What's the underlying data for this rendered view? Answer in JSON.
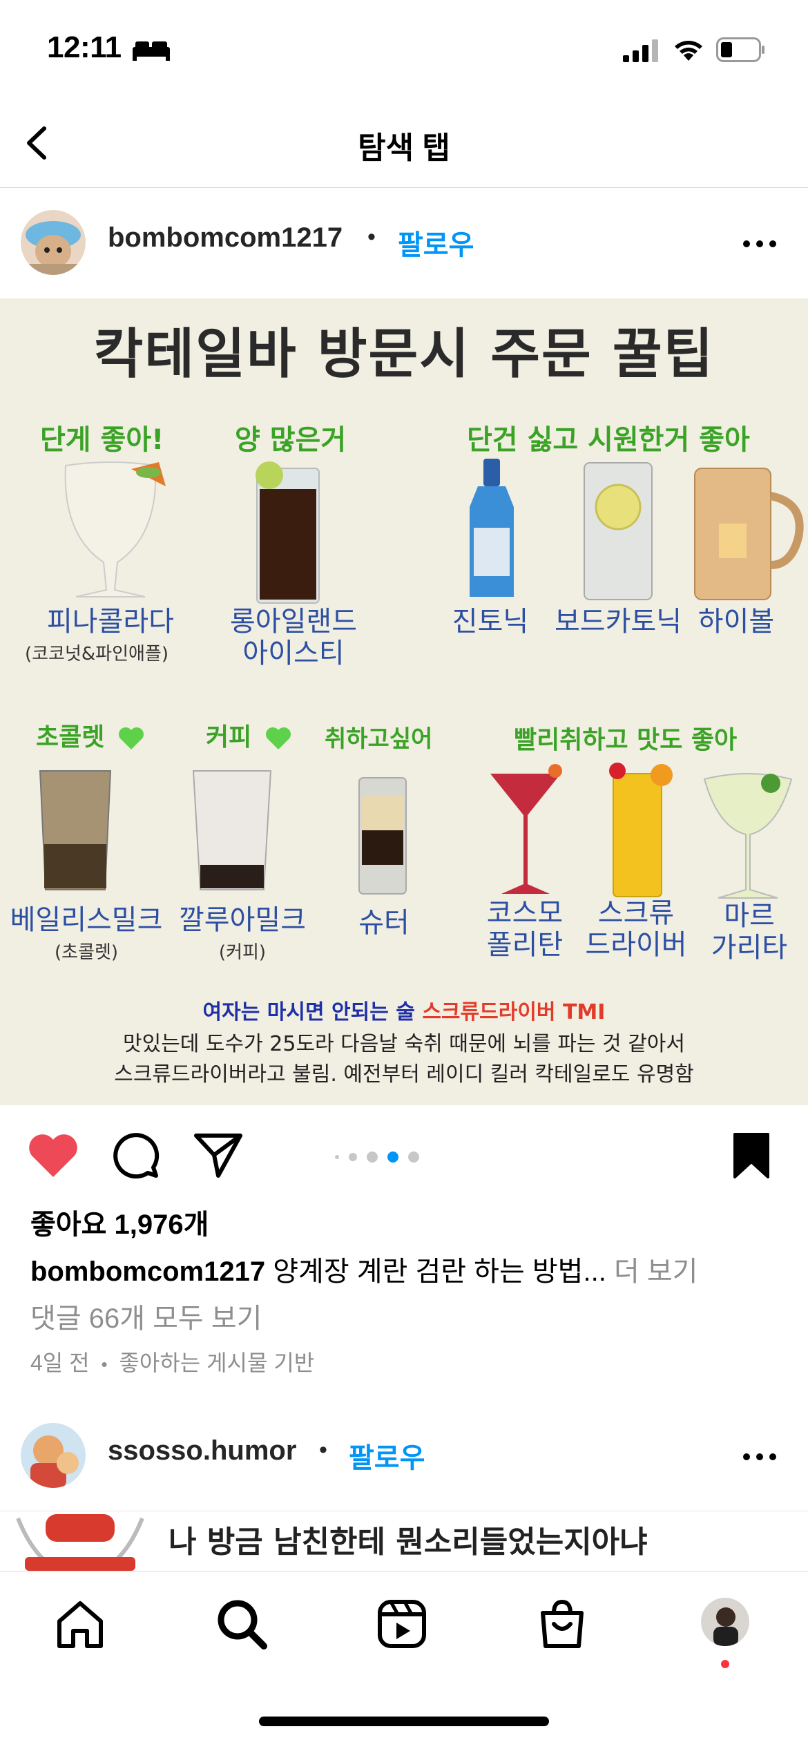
{
  "status_bar": {
    "time": "12:11"
  },
  "header": {
    "title": "탐색 탭"
  },
  "post": {
    "username": "bombomcom1217",
    "separator": "•",
    "follow_label": "팔로우",
    "image": {
      "title": "칵테일바 방문시 주문 꿀팁",
      "categories": {
        "sweet": "단게 좋아!",
        "volume": "양 많은거",
        "light": "단건 싫고 시원한거 좋아",
        "chocolate": "초콜렛",
        "coffee": "커피",
        "drunk": "취하고싶어",
        "fast": "빨리취하고 맛도 좋아"
      },
      "drinks": {
        "pina": "피나콜라다",
        "pina_sub": "(코코넛&파인애플)",
        "longisland_1": "롱아일랜드",
        "longisland_2": "아이스티",
        "gintonic": "진토닉",
        "vodka": "보드카토닉",
        "highball": "하이볼",
        "baileys": "베일리스밀크",
        "baileys_sub": "(초콜렛)",
        "kahlua": "깔루아밀크",
        "kahlua_sub": "(커피)",
        "shooter": "슈터",
        "cosmo_1": "코스모",
        "cosmo_2": "폴리탄",
        "screw_1": "스크류",
        "screw_2": "드라이버",
        "marg_1": "마르",
        "marg_2": "가리타"
      },
      "warning_prefix": "여자는 마시면 안되는 술 ",
      "warning_highlight": "스크류드라이버 TMI",
      "body_line1": "맛있는데 도수가 25도라  다음날 숙취 때문에 뇌를 파는 것 같아서",
      "body_line2": "스크류드라이버라고 불림.  예전부터 레이디 킬러 칵테일로도 유명함"
    },
    "likes": "좋아요 1,976개",
    "caption_user": "bombomcom1217",
    "caption_text": " 양계장 계란 검란 하는 방법...",
    "caption_more": " 더 보기",
    "comments_link": "댓글 66개 모두 보기",
    "time_ago": "4일 전",
    "meta_sep": "•",
    "recommend_reason": "좋아하는 게시물 기반"
  },
  "post2": {
    "username": "ssosso.humor",
    "separator": "•",
    "follow_label": "팔로우",
    "image_text": "나 방금 남친한테 뭔소리들었는지아냐"
  },
  "colors": {
    "accent": "#0095f6",
    "like": "#ed4956",
    "category_green": "#3aa326",
    "name_blue": "#2c4fa3",
    "notification": "#ff3040"
  }
}
